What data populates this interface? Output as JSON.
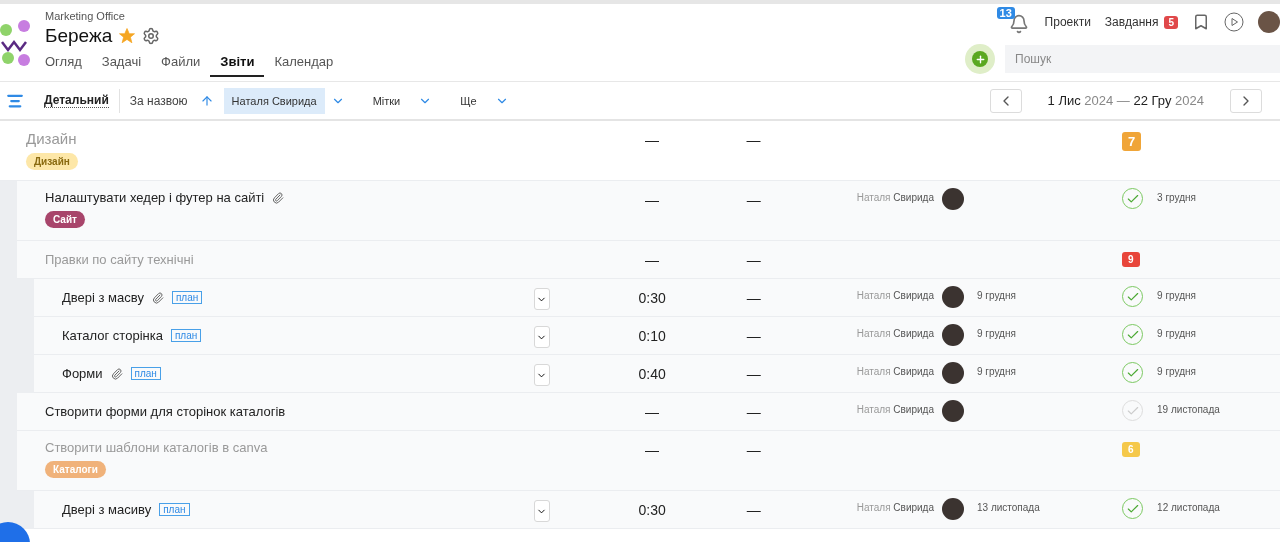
{
  "header": {
    "workspace": "Marketing Office",
    "project": "Бережа",
    "starred": true,
    "tabs": [
      {
        "label": "Огляд",
        "selected": false
      },
      {
        "label": "Задачі",
        "selected": false
      },
      {
        "label": "Файли",
        "selected": false
      },
      {
        "label": "Звіти",
        "selected": true
      },
      {
        "label": "Календар",
        "selected": false
      }
    ],
    "notifications": "13",
    "nav": [
      {
        "label": "Проекти"
      },
      {
        "label": "Завдання",
        "badge": "5"
      }
    ],
    "search": {
      "placeholder": "Пошук"
    }
  },
  "toolbar": {
    "view": "Детальний",
    "sort": "За назвою",
    "filters": [
      {
        "label": "Наталя Свирида",
        "selected": true
      },
      {
        "label": "Мітки",
        "selected": false
      },
      {
        "label": "Ще",
        "selected": false
      }
    ],
    "date_range": "**1 Лис** 2024 — **22 Гру** 2024"
  },
  "rows": [
    {
      "kind": "group",
      "title": "Дизайн",
      "tag": {
        "label": "Дизайн",
        "color": "#fde7a8"
      },
      "column_2": "—",
      "column_3": "—",
      "count": {
        "label": "7",
        "color": "#f0a538"
      },
      "children": [
        {
          "kind": "task",
          "title": "Налаштувати хедер і футер на сайті",
          "attachment": true,
          "tag": {
            "label": "Сайт",
            "color": "#a8456b"
          },
          "column_2": "—",
          "column_3": "—",
          "assignee": "Наталя **Свирида**",
          "done": true,
          "due": "3 грудня"
        },
        {
          "kind": "group",
          "title": "Правки по сайту технічні",
          "column_2": "—",
          "column_3": "—",
          "count": {
            "label": "9",
            "color": "#e8453a"
          },
          "children": [
            {
              "kind": "task",
              "title": "Двері з масву",
              "attachment": true,
              "plan": "план",
              "column_2": "0:30",
              "column_3": "—",
              "assignee": "Наталя **Свирида**",
              "date": "9 грудня",
              "done": true,
              "due": "9 грудня"
            },
            {
              "kind": "task",
              "title": "Каталог сторінка",
              "attachment": false,
              "plan": "план",
              "column_2": "0:10",
              "column_3": "—",
              "assignee": "Наталя **Свирида**",
              "date": "9 грудня",
              "done": true,
              "due": "9 грудня"
            },
            {
              "kind": "task",
              "title": "Форми",
              "attachment": true,
              "plan": "план",
              "column_2": "0:40",
              "column_3": "—",
              "assignee": "Наталя **Свирида**",
              "date": "9 грудня",
              "done": true,
              "due": "9 грудня"
            }
          ]
        },
        {
          "kind": "task",
          "title": "Створити форми для сторінок каталогів",
          "attachment": false,
          "column_2": "—",
          "column_3": "—",
          "assignee": "Наталя **Свирида**",
          "done": false,
          "due": "19 листопада"
        },
        {
          "kind": "group",
          "title": "Створити шаблони каталогів в canva",
          "tag": {
            "label": "Каталоги",
            "color": "#f0b27a"
          },
          "column_2": "—",
          "column_3": "—",
          "count": {
            "label": "6",
            "color": "#f5c84a"
          },
          "children": [
            {
              "kind": "task",
              "title": "Двері з масиву",
              "attachment": false,
              "plan": "план",
              "column_2": "0:30",
              "column_3": "—",
              "assignee": "Наталя **Свирида**",
              "date": "13 листопада",
              "done": true,
              "due": "12 листопада"
            }
          ]
        }
      ]
    }
  ]
}
